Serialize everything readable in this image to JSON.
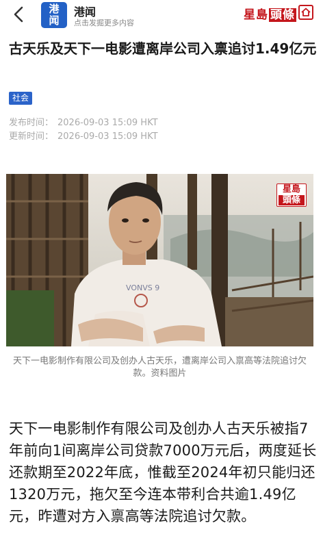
{
  "header": {
    "app_logo_top": "港",
    "app_logo_bottom": "闻",
    "app_name": "港闻",
    "app_subtitle": "点击发掘更多内容",
    "brand_part1": "星島",
    "brand_part2": "頭條"
  },
  "article": {
    "title": "古天乐及天下一电影遭离岸公司入禀追讨1.49亿元",
    "tag": "社会",
    "published_label": "发布时间：",
    "published_value": "2026-09-03 15:09 HKT",
    "updated_label": "更新时间：",
    "updated_value": "2026-09-03 15:09 HKT",
    "photo_watermark_1": "星島",
    "photo_watermark_2": "頭條",
    "caption": "天下一电影制作有限公司及创办人古天乐，遭离岸公司入禀高等法院追讨欠款。资料图片",
    "body": "天下一电影制作有限公司及创办人古天乐被指7年前向1间离岸公司贷款7000万元后，两度延长还款期至2022年底，惟截至2024年初只能归还1320万元，拖欠至今连本带利合共逾1.49亿元，昨遭对方入禀高等法院追讨欠款。"
  },
  "colors": {
    "brand_red": "#c4161c",
    "tag_blue": "#2b63c9",
    "app_blue": "#2361c6"
  }
}
